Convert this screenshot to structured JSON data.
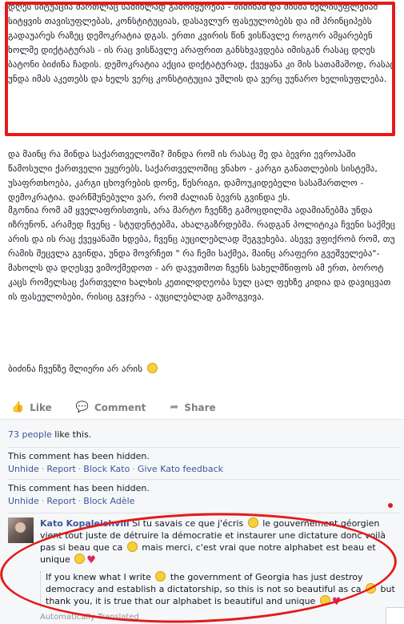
{
  "post": {
    "paragraph1": "დღეს სიტუაცია მართლაც საშინლად გამოიყურება - ბიძინამ და მისმა ხელისუფლებამ სიტყვის თავისუფლებას, კონსტიტუციას, დასავლურ ფასეულობებს და იმ პრინციპებს გადაუარეს რაზეც დემოკრატია დგას. ერთი კვირის წინ ვისწავლე როგორ ამყარებენ ხოლმე დიქტატურას - ის რაც ვისწავლე არაფრით განსხვავდება იმისგან რასაც დღეს ბატონი ბიძინა ჩადის. დემოკრატია აქცია დიქტატურად, ქვეყანა კი მის სათამაშოდ, რასაც უნდა იმას აკეთებს და ხელს ვერც კონსტიტუცია უშლის და ვერც უუნარო ხელისუფლება.",
    "paragraph2": "და მაინც რა მინდა საქართველოში? მინდა რომ ის რასაც მე და ბევრი ევროპაში წამოსული ქართველი უყურებს, საქართველოშიც ვნახო - კარგი განათლების სისტემა, უსაფრთხოება, კარგი ცხოვრების დონე, წესრიგი, დამოუკიდებელი სასამართლო - დემოკრატია. დარწმუნებული ვარ, რომ ძალიან ბევრს გვინდა ეს.",
    "paragraph3": "მგონია რომ ამ ყველაფრისთვის, არა მარტო ჩვენზე გამოცდილმა ადამიანებმა უნდა იზრუნონ, არამედ ჩვენც - სტუდენტებმა, ახალგაზრდებმა. რადგან პოლიტიკა ჩვენი საქმეც არის და ის რაც ქვეყანაში ხდება, ჩვენც აუცილებლად შეგვეხება. ასევე ვფიქრობ რომ, თუ რამის შეცვლა გვინდა, უნდა მოვრჩეთ \" რა ჩემი საქმეა, მაინც არაფერი გვეშველება\"-მახოლს და დღესვე ვიმოქმედოთ - არ დავუთმოთ ჩვენს სახელმწიფოს ამ ერთ, ბოროტ კაცს რომელსაც ქართველი ხალხის კეთილდღეობა სულ ცალ ფეხზე კიდია და დავიცვათ ის ფასეულობები, რისიც გვჯერა - აუცილებლად გამოგვივა.",
    "paragraph4": "ბიძინა ჩვენზე მლიერი არ არის"
  },
  "actions": {
    "like": "Like",
    "comment": "Comment",
    "share": "Share"
  },
  "feed": {
    "likes_count": "73 people",
    "likes_suffix": " like this.",
    "hidden1": {
      "text": "This comment has been hidden.",
      "unhide": "Unhide",
      "report": "Report",
      "block": "Block Kato",
      "feedback": "Give Kato feedback"
    },
    "hidden2": {
      "text": "This comment has been hidden.",
      "unhide": "Unhide",
      "report": "Report",
      "block": "Block Adèle"
    },
    "comment": {
      "author": "Kato Kopaleishvili",
      "text_a": " Si tu savais ce que j'écris ",
      "text_b": " le gouvernement géorgien vient tout juste de détruire la démocratie et instaurer une dictature donc voilà pas si beau que ca ",
      "text_c": " mais merci, c'est vrai que notre alphabet est beau et unique ",
      "translation_a": "If you knew what I write ",
      "translation_b": " the government of Georgia has just destroy democracy and establish a dictatorship, so this is not so beautiful as ca ",
      "translation_c": " but thank you, it is true that our alphabet is beautiful and unique ",
      "auto_label": "Automatically Translated"
    }
  },
  "colors": {
    "annotation_red": "#e31b1b",
    "link_blue": "#3b5998",
    "feed_bg": "#f6f7f9"
  }
}
